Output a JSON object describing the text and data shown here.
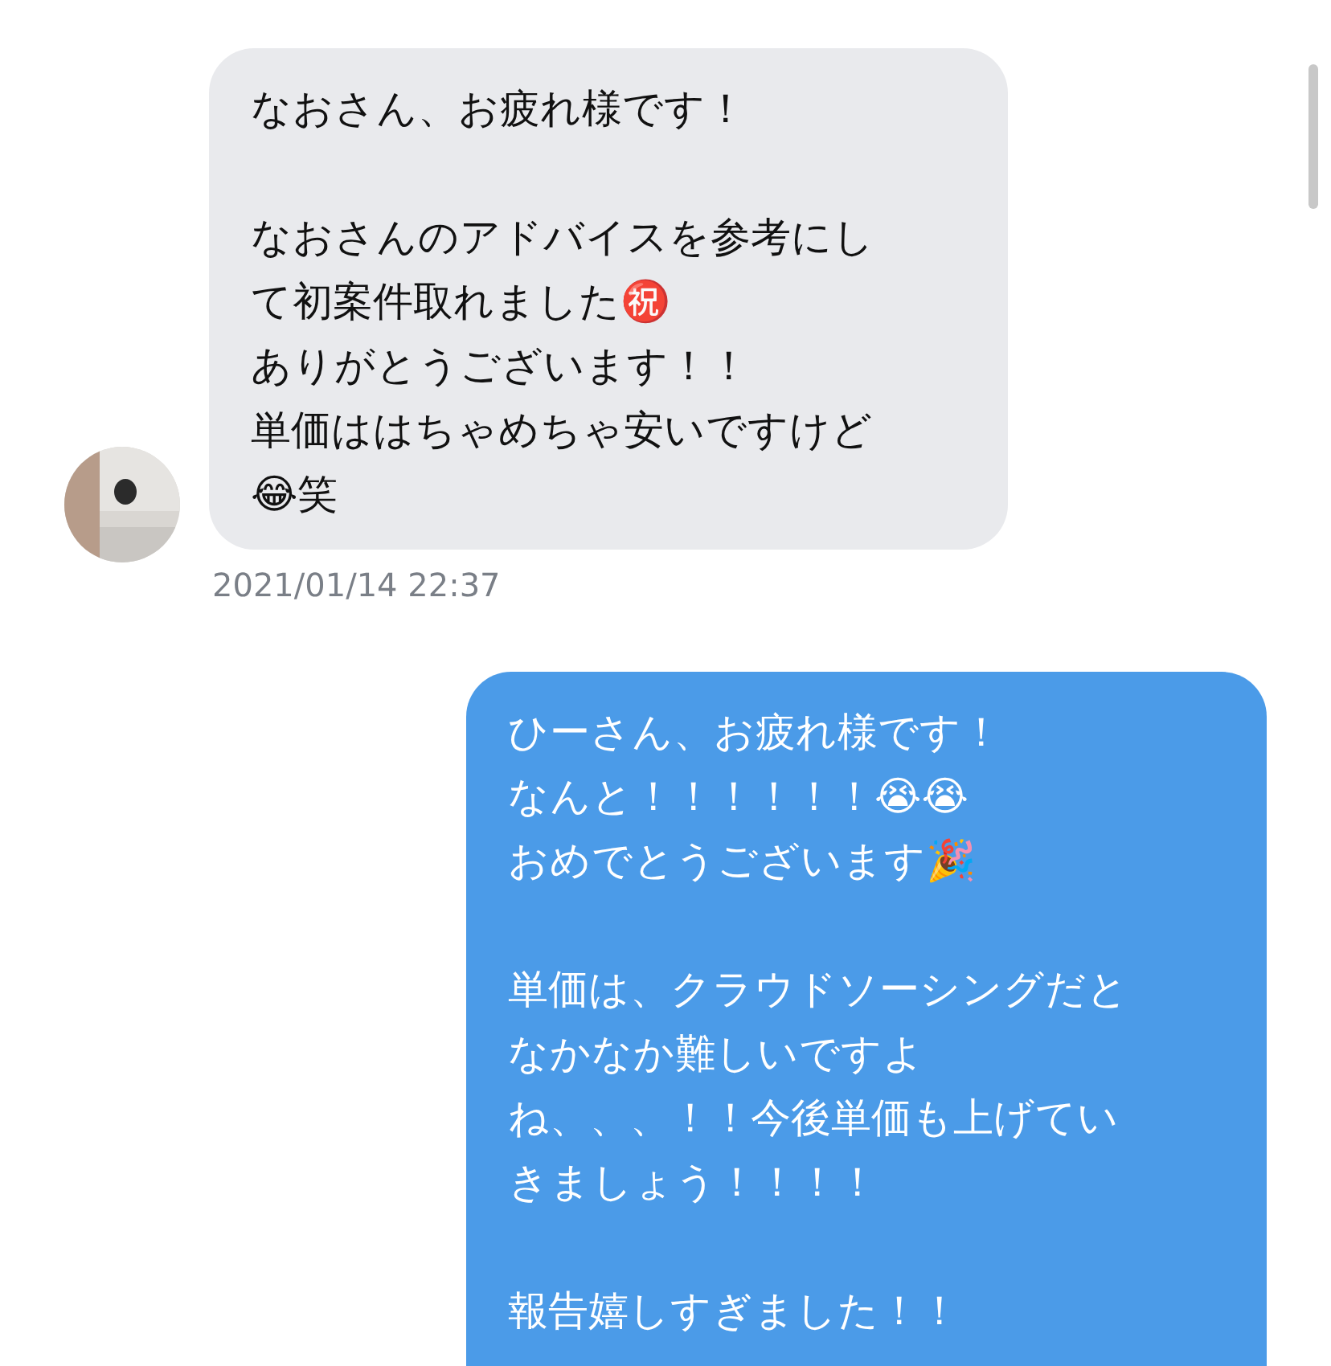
{
  "messages": [
    {
      "kind": "incoming",
      "paragraphs": [
        [
          "なおさん、お疲れ様です！"
        ],
        [
          "なおさんのアドバイスを参考にし",
          "て初案件取れました㊗️",
          "ありがとうございます！！",
          "単価ははちゃめちゃ安いですけど",
          "😂笑"
        ]
      ],
      "time": "2021/01/14 22:37",
      "avatar": {
        "kind": "picture"
      }
    },
    {
      "kind": "outgoing",
      "paragraphs": [
        [
          "ひーさん、お疲れ様です！",
          "なんと！！！！！！😭😭",
          "おめでとうございます🎉"
        ],
        [
          "単価は、クラウドソーシングだと",
          "なかなか難しいですよ",
          "ね、、、！！今後単価も上げてい",
          "きましょう！！！！"
        ],
        [
          "報告嬉しすぎました！！"
        ]
      ]
    }
  ]
}
